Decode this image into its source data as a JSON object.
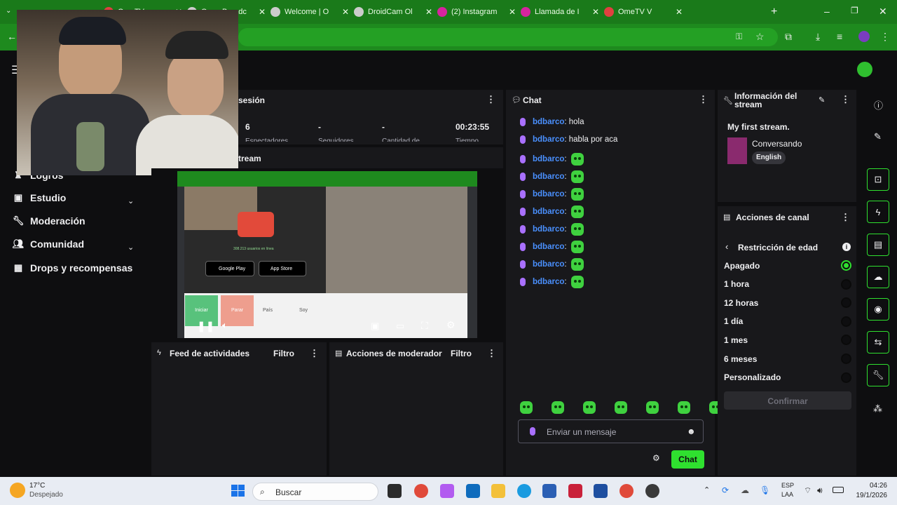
{
  "browser": {
    "tabs": [
      {
        "label": "OmeTV",
        "color": "#e04040"
      },
      {
        "label": "Open Broadc",
        "color": "#cccccc"
      },
      {
        "label": "Welcome | O",
        "color": "#cccccc"
      },
      {
        "label": "DroidCam Ol",
        "color": "#cccccc"
      },
      {
        "label": "(2) Instagram",
        "color": "#d6249f"
      },
      {
        "label": "Llamada de I",
        "color": "#d6249f"
      },
      {
        "label": "OmeTV V",
        "color": "#e04040"
      }
    ],
    "new_tab": "+"
  },
  "nav": {
    "items": [
      {
        "label": "Logros",
        "icon": "trophy-icon"
      },
      {
        "label": "Estudio",
        "icon": "film-icon"
      },
      {
        "label": "Moderación",
        "icon": "wrench-icon"
      },
      {
        "label": "Comunidad",
        "icon": "people-icon"
      },
      {
        "label": "Drops y recompensas",
        "icon": "gift-icon"
      }
    ]
  },
  "session": {
    "title": "sesión",
    "stats": [
      {
        "value": "6",
        "label": "Espectadores"
      },
      {
        "value": "-",
        "label": "Seguidores"
      },
      {
        "value": "-",
        "label": "Cantidad de"
      },
      {
        "value": "00:23:55",
        "label": "Tiempo"
      }
    ]
  },
  "stream_preview": {
    "title": "tream"
  },
  "preview_content": {
    "users_online": "308.213 usuarios en línea",
    "google_play": "Google Play",
    "app_store": "App Store",
    "btn_start": "Iniciar",
    "btn_stop": "Parar",
    "btn_country": "País",
    "btn_soy": "Soy"
  },
  "feed": {
    "title": "Feed de actividades",
    "filter": "Filtro"
  },
  "modactions": {
    "title": "Acciones de moderador",
    "filter": "Filtro"
  },
  "chat": {
    "title": "Chat",
    "messages": [
      {
        "user": "bdbarco",
        "text": ": hola"
      },
      {
        "user": "bdbarco",
        "text": ": habla por aca"
      },
      {
        "user": "bdbarco",
        "text": ":"
      },
      {
        "user": "bdbarco",
        "text": ":"
      },
      {
        "user": "bdbarco",
        "text": ":"
      },
      {
        "user": "bdbarco",
        "text": ":"
      },
      {
        "user": "bdbarco",
        "text": ":"
      },
      {
        "user": "bdbarco",
        "text": ":"
      },
      {
        "user": "bdbarco",
        "text": ":"
      },
      {
        "user": "bdbarco",
        "text": ":"
      }
    ],
    "input_placeholder": "Enviar un mensaje",
    "send_label": "Chat"
  },
  "stream_info": {
    "title": "Información del stream",
    "stream_title": "My first stream.",
    "category": "Conversando",
    "language": "English"
  },
  "channel_actions": {
    "title": "Acciones de canal",
    "subtitle": "Restricción de edad",
    "options": [
      {
        "label": "Apagado",
        "selected": true
      },
      {
        "label": "1 hora",
        "selected": false
      },
      {
        "label": "12 horas",
        "selected": false
      },
      {
        "label": "1 día",
        "selected": false
      },
      {
        "label": "1 mes",
        "selected": false
      },
      {
        "label": "6 meses",
        "selected": false
      },
      {
        "label": "Personalizado",
        "selected": false
      }
    ],
    "confirm": "Confirmar"
  },
  "taskbar": {
    "weather_temp": "17°C",
    "weather_desc": "Despejado",
    "search": "Buscar",
    "lang": "ESP",
    "lang2": "LAA",
    "time": "04:26",
    "date": "19/1/2026"
  },
  "colors": {
    "accent": "#2fe02f",
    "chat_user": "#4a90ff",
    "browser": "#1e8a1e"
  }
}
